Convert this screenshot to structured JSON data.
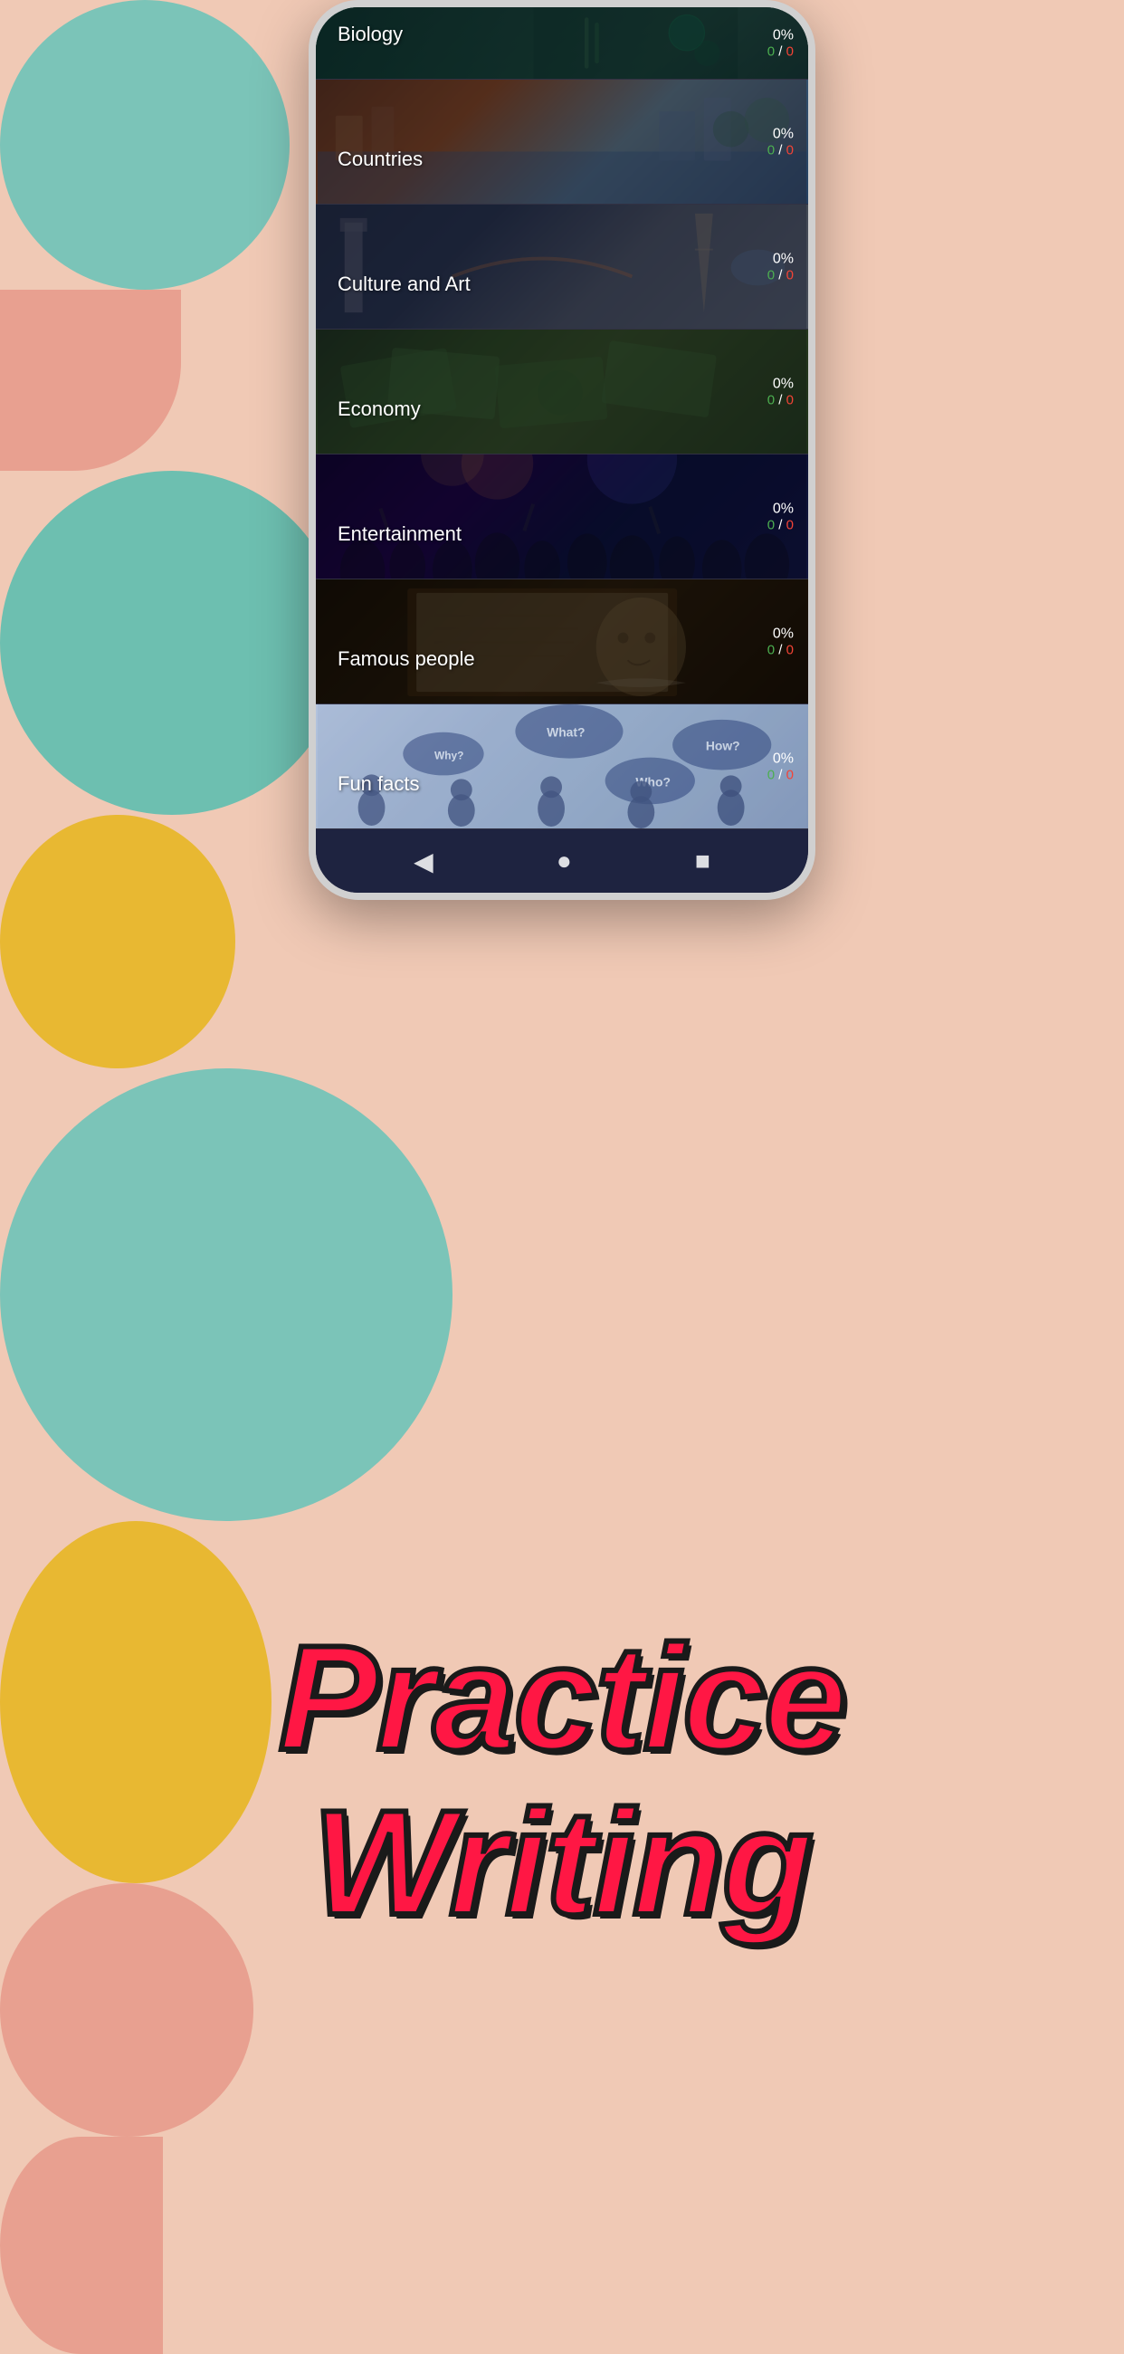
{
  "background": {
    "color": "#f0c9b5"
  },
  "categories": [
    {
      "id": "biology",
      "label": "Biology",
      "percent": "0%",
      "correct": "0",
      "total": "0",
      "partial": true
    },
    {
      "id": "countries",
      "label": "Countries",
      "percent": "0%",
      "correct": "0",
      "total": "0",
      "partial": false
    },
    {
      "id": "culture",
      "label": "Culture and Art",
      "percent": "0%",
      "correct": "0",
      "total": "0",
      "partial": false
    },
    {
      "id": "economy",
      "label": "Economy",
      "percent": "0%",
      "correct": "0",
      "total": "0",
      "partial": false
    },
    {
      "id": "entertainment",
      "label": "Entertainment",
      "percent": "0%",
      "correct": "0",
      "total": "0",
      "partial": false
    },
    {
      "id": "famous",
      "label": "Famous people",
      "percent": "0%",
      "correct": "0",
      "total": "0",
      "partial": false
    },
    {
      "id": "funfacts",
      "label": "Fun facts",
      "percent": "0%",
      "correct": "0",
      "total": "0",
      "partial": false
    }
  ],
  "nav": {
    "back_icon": "◀",
    "home_icon": "●",
    "recent_icon": "■"
  },
  "bottom_text": {
    "line1": "Practice",
    "line2": "Writing"
  }
}
